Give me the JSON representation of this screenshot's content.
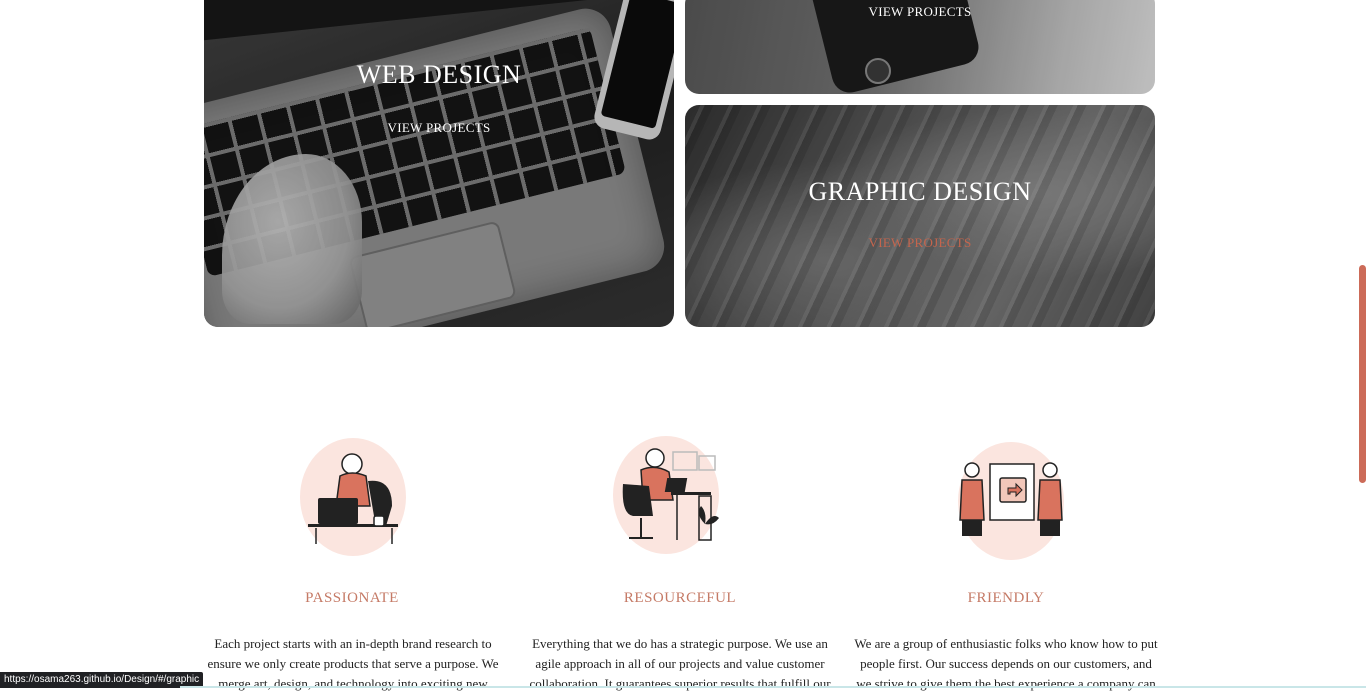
{
  "cards": [
    {
      "title": "WEB DESIGN",
      "link": "VIEW PROJECTS"
    },
    {
      "title": "",
      "link": "VIEW PROJECTS"
    },
    {
      "title": "GRAPHIC DESIGN",
      "link": "VIEW PROJECTS"
    }
  ],
  "features": [
    {
      "title": "PASSIONATE",
      "lines": [
        "Each project starts with an in-depth brand research to",
        "ensure we only create products that serve a purpose. We",
        "merge art, design, and technology into exciting new"
      ],
      "icon": "person-laptop-illustration"
    },
    {
      "title": "RESOURCEFUL",
      "lines": [
        "Everything that we do has a strategic purpose. We use an",
        "agile approach in all of our projects and value customer",
        "collaboration. It guarantees superior results that fulfill our"
      ],
      "icon": "person-desk-illustration"
    },
    {
      "title": "FRIENDLY",
      "lines": [
        "We are a group of enthusiastic folks who know how to put",
        "people first. Our success depends on our customers, and",
        "we strive to give them the best experience a company can"
      ],
      "icon": "people-share-illustration"
    }
  ],
  "status": {
    "url": "https://osama263.github.io/Design/#/graphic"
  },
  "colors": {
    "accent": "#c57a66",
    "scrollbar": "#cc6b58",
    "blob": "#fbe5df"
  }
}
